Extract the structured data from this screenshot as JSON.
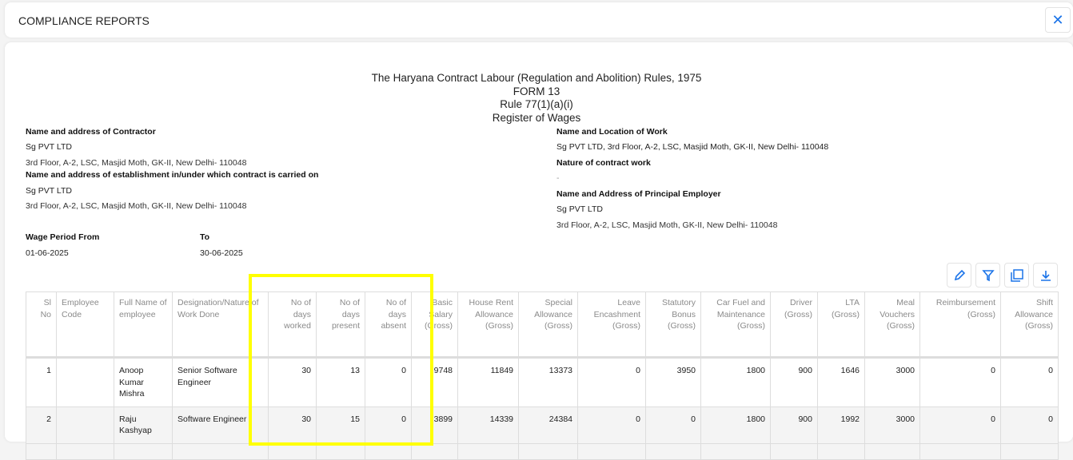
{
  "header": {
    "title": "COMPLIANCE REPORTS",
    "close_label": "✕"
  },
  "form": {
    "line1": "The Haryana Contract Labour (Regulation and Abolition) Rules, 1975",
    "line2": "FORM 13",
    "line3": "Rule 77(1)(a)(i)",
    "line4": "Register of Wages"
  },
  "contractor": {
    "label": "Name and address of Contractor",
    "name": "Sg PVT LTD",
    "address": "3rd Floor, A-2, LSC, Masjid Moth, GK-II, New Delhi- 110048"
  },
  "establishment": {
    "label": "Name and address of establishment in/under which contract is carried on",
    "name": "Sg PVT LTD",
    "address": "3rd Floor, A-2, LSC, Masjid Moth, GK-II, New Delhi- 110048"
  },
  "work_location": {
    "label": "Name and Location of Work",
    "value": "Sg PVT LTD, 3rd Floor, A-2, LSC, Masjid Moth, GK-II, New Delhi- 110048"
  },
  "nature": {
    "label": "Nature of contract work",
    "value": "-"
  },
  "principal": {
    "label": "Name and Address of Principal Employer",
    "name": "Sg PVT LTD",
    "address": "3rd Floor, A-2, LSC, Masjid Moth, GK-II, New Delhi- 110048"
  },
  "wage_period": {
    "from_label": "Wage Period From",
    "from": "01-06-2025",
    "to_label": "To",
    "to": "30-06-2025"
  },
  "toolbar": [
    "edit-icon",
    "filter-icon",
    "pdf-icon",
    "download-icon"
  ],
  "accent": "#1a73e8",
  "table": {
    "columns": [
      "Sl No",
      "Employee Code",
      "Full Name of employee",
      "Designation/Nature of Work Done",
      "No of days worked",
      "No of days present",
      "No of days absent",
      "Basic Salary (Gross)",
      "House Rent Allowance (Gross)",
      "Special Allowance (Gross)",
      "Leave Encashment (Gross)",
      "Statutory Bonus (Gross)",
      "Car Fuel and Maintenance (Gross)",
      "Driver (Gross)",
      "LTA (Gross)",
      "Meal Vouchers (Gross)",
      "Reimbursement (Gross)",
      "Shift Allowance (Gross)"
    ],
    "rows": [
      [
        "1",
        "",
        "Anoop Kumar Mishra",
        "Senior Software Engineer",
        "30",
        "13",
        "0",
        "9748",
        "11849",
        "13373",
        "0",
        "3950",
        "1800",
        "900",
        "1646",
        "3000",
        "0",
        "0"
      ],
      [
        "2",
        "",
        "Raju Kashyap",
        "Software Engineer",
        "30",
        "15",
        "0",
        "3899",
        "14339",
        "24384",
        "0",
        "0",
        "1800",
        "900",
        "1992",
        "3000",
        "0",
        "0"
      ]
    ]
  }
}
